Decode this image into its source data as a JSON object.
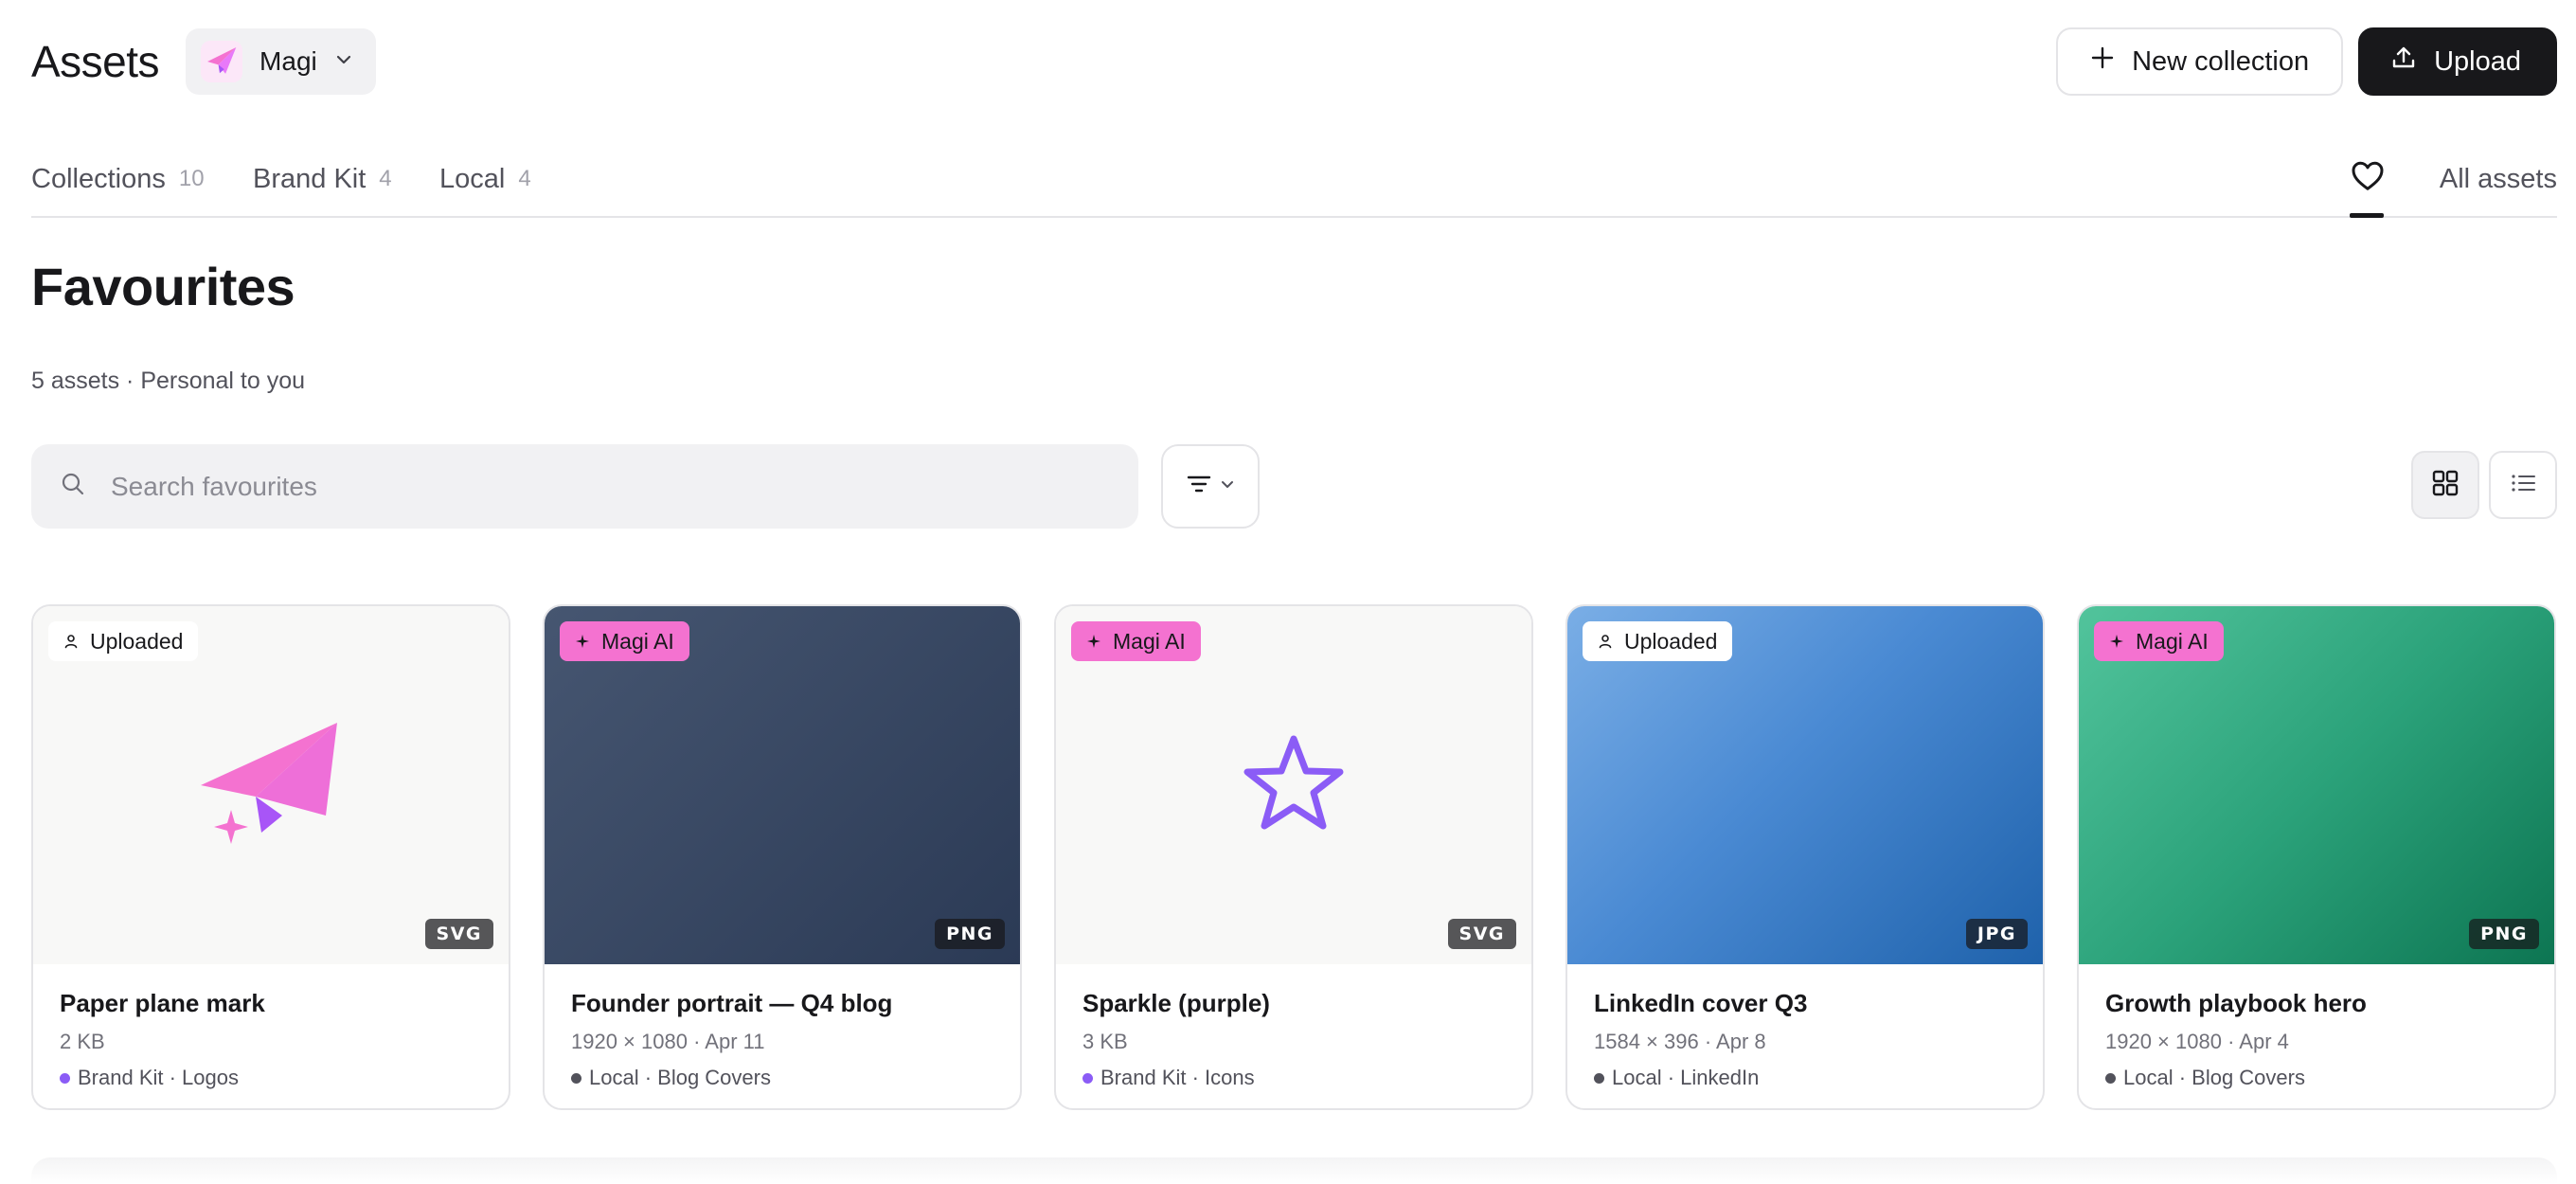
{
  "header": {
    "title": "Assets",
    "workspace": {
      "name": "Magi",
      "logo_icon": "paper-plane-icon"
    },
    "new_collection_label": "New collection",
    "upload_label": "Upload"
  },
  "tabs": [
    {
      "label": "Collections",
      "count": "10"
    },
    {
      "label": "Brand Kit",
      "count": "4"
    },
    {
      "label": "Local",
      "count": "4"
    }
  ],
  "favourites_tab": {
    "icon": "heart-icon",
    "active": true
  },
  "all_assets_label": "All assets",
  "page": {
    "title": "Favourites",
    "subtitle": "5 assets · Personal to you"
  },
  "search": {
    "placeholder": "Search favourites",
    "value": ""
  },
  "view_mode": "grid",
  "colors": {
    "accent_pink": "#f472d0",
    "brand_purple": "#8b5cf6",
    "dark": "#18181b"
  },
  "assets": [
    {
      "name": "Paper plane mark",
      "details": "2 KB",
      "location": "Brand Kit · Logos",
      "source": "Uploaded",
      "format": "SVG",
      "dot_color": "#8b5cf6",
      "preview": "paper-plane-icon"
    },
    {
      "name": "Founder portrait — Q4 blog",
      "details": "1920 × 1080 · Apr 11",
      "location": "Local · Blog Covers",
      "source": "Magi AI",
      "format": "PNG",
      "dot_color": "#52525b",
      "preview": "slate-gradient"
    },
    {
      "name": "Sparkle (purple)",
      "details": "3 KB",
      "location": "Brand Kit · Icons",
      "source": "Magi AI",
      "format": "SVG",
      "dot_color": "#8b5cf6",
      "preview": "star-icon"
    },
    {
      "name": "LinkedIn cover Q3",
      "details": "1584 × 396 · Apr 8",
      "location": "Local · LinkedIn",
      "source": "Uploaded",
      "format": "JPG",
      "dot_color": "#52525b",
      "preview": "blue-gradient"
    },
    {
      "name": "Growth playbook hero",
      "details": "1920 × 1080 · Apr 4",
      "location": "Local · Blog Covers",
      "source": "Magi AI",
      "format": "PNG",
      "dot_color": "#52525b",
      "preview": "green-gradient"
    }
  ]
}
